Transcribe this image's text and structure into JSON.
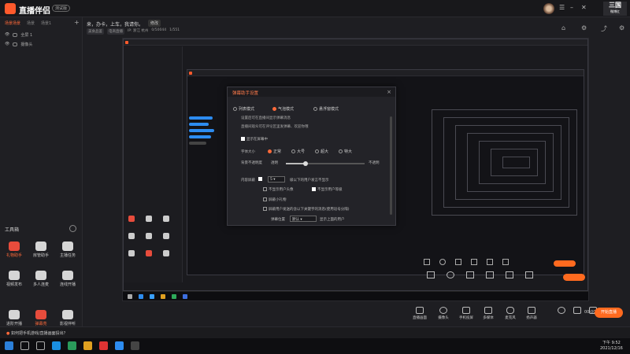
{
  "app": {
    "name": "直播伴侣",
    "version": "测试版",
    "brand": "三国",
    "brand_sub": "微博红"
  },
  "scenes": {
    "tabs": [
      "场景场景",
      "场景",
      "场景1"
    ],
    "sources": [
      "全屏 1",
      "摄像头"
    ]
  },
  "room": {
    "title": "来，办卡，上车，我请你。",
    "edit": "修改",
    "tags": [
      "美食品鉴",
      "电商直播",
      "IP: 浙江 杭州",
      "0/50044",
      "1/551"
    ]
  },
  "tools": {
    "title": "工具箱",
    "items": [
      "礼物助手",
      "房管助手",
      "主播任务",
      "视频发布",
      "多人连麦",
      "连线开播",
      "进阶开播",
      "弹幕亮",
      "影视伴听"
    ]
  },
  "dialog": {
    "title": "弹幕助手设置",
    "modes": [
      "列表模式",
      "气泡模式",
      "悬浮窗模式"
    ],
    "desc1": "设置后可在直播间显示弹幕消息",
    "desc2": "直播间观众可在评论区里发弹幕、欢迎你哦",
    "show_on_screen": "显示在屏幕中",
    "font_label": "字体大小",
    "font_sizes": [
      "正常",
      "大号",
      "超大",
      "特大"
    ],
    "opacity_label": "背景不透明度",
    "opacity_left": "透明",
    "opacity_right": "不透明",
    "opacity_value": 0.25,
    "filter_label": "内容屏蔽",
    "filter_level": "5",
    "filter_text": "级以下的用户发言不显示",
    "opt1": "不显示用户头像",
    "opt2": "不显示用户等级",
    "opt3": "屏蔽小礼物",
    "opt4": "屏蔽用户发送的含以下关键字的消息(使用逗号分隔)",
    "bottom_label": "弹幕位置",
    "bottom_value": "默认",
    "bottom_hint": "显示上面的用户"
  },
  "bottom_toolbar": [
    "直播画面",
    "摄像头",
    "手机投屏",
    "多媒体",
    "麦克风",
    "扬声器"
  ],
  "start_live": "开始直播",
  "live_time": "00:00:00",
  "status": "如何把手机游戏/直播画面投出？",
  "clock": {
    "time": "下午 9:52",
    "date": "2021/12/16"
  }
}
